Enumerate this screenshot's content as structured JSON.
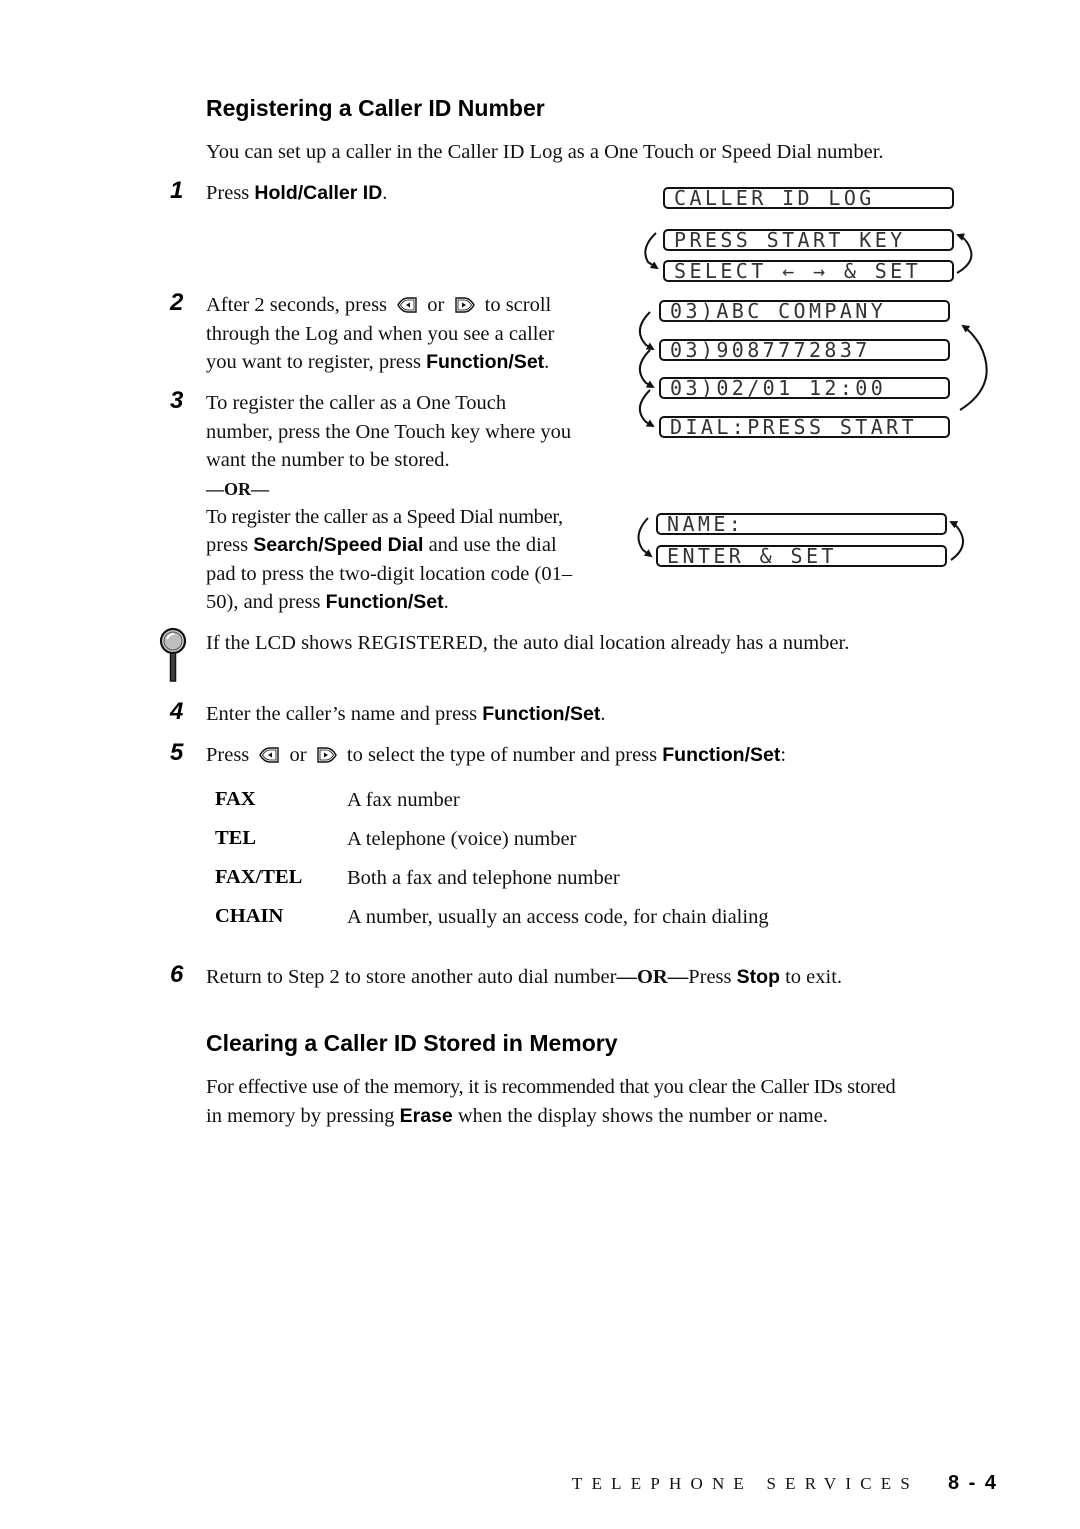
{
  "section1": {
    "title": "Registering a Caller ID Number",
    "intro": "You can set up a caller in the Caller ID Log as a One Touch or Speed Dial number."
  },
  "steps": [
    {
      "num": "1",
      "pre": "Press ",
      "bold": "Hold/Caller ID",
      "post": "."
    },
    {
      "num": "2",
      "line1_a": "After 2 seconds, press",
      "line1_or": "or",
      "line1_b": "to scroll",
      "line2": "through the Log and when you see a caller",
      "line3_pre": "you want to register, press ",
      "line3_bold": "Function/Set",
      "line3_post": "."
    },
    {
      "num": "3",
      "line1": "To register the caller as a One Touch",
      "line2": "number, press the One Touch key where you",
      "line3": "want the number to be stored.",
      "or": "—OR—",
      "alt1": "To register the caller as a Speed Dial number,",
      "alt2_pre": "press ",
      "alt2_bold": "Search/Speed Dial",
      "alt2_post": " and use the dial",
      "alt3": "pad to press the two-digit location code (01–",
      "alt4_pre": "50), and press ",
      "alt4_bold": "Function/Set",
      "alt4_post": "."
    },
    {
      "num": "4",
      "pre": "Enter the caller’s name and press ",
      "bold": "Function/Set",
      "post": "."
    },
    {
      "num": "5",
      "pre": "Press",
      "or": "or",
      "mid": "to select the type of number and press ",
      "bold": "Function/Set",
      "post": ":"
    },
    {
      "num": "6",
      "pre": "Return to Step 2 to store another auto dial number",
      "or": "—OR—",
      "mid": "Press ",
      "bold": "Stop",
      "post": " to exit."
    }
  ],
  "note": {
    "icon": "magnifier-icon",
    "text": "If the LCD shows REGISTERED, the auto dial location already has a number."
  },
  "number_types": [
    {
      "label": "FAX",
      "desc": "A fax number"
    },
    {
      "label": "TEL",
      "desc": "A telephone (voice) number"
    },
    {
      "label": "FAX/TEL",
      "desc": "Both a fax and telephone number"
    },
    {
      "label": "CHAIN",
      "desc": "A number, usually an access code, for chain dialing"
    }
  ],
  "lcd": {
    "caller_id_log": "CALLER ID LOG",
    "press_start_key": "PRESS START KEY",
    "select_set": "SELECT ← → & SET",
    "entry_name": "03)ABC COMPANY",
    "entry_number": "03)9087772837",
    "entry_datetime": "03)02/01 12:00",
    "dial_press_start": "DIAL:PRESS START",
    "name_prompt": "NAME:",
    "enter_set": "ENTER & SET"
  },
  "section2": {
    "title": "Clearing a Caller ID Stored in Memory",
    "line1": "For effective use of the memory, it is recommended that you clear the Caller IDs stored",
    "line2_pre": "in memory by pressing ",
    "line2_bold": "Erase",
    "line2_post": " when the display shows the number or name."
  },
  "footer": {
    "chapter": "TELEPHONE SERVICES",
    "page": "8 - 4"
  },
  "icons": {
    "left_key": "left-arrow-key-icon",
    "right_key": "right-arrow-key-icon"
  }
}
